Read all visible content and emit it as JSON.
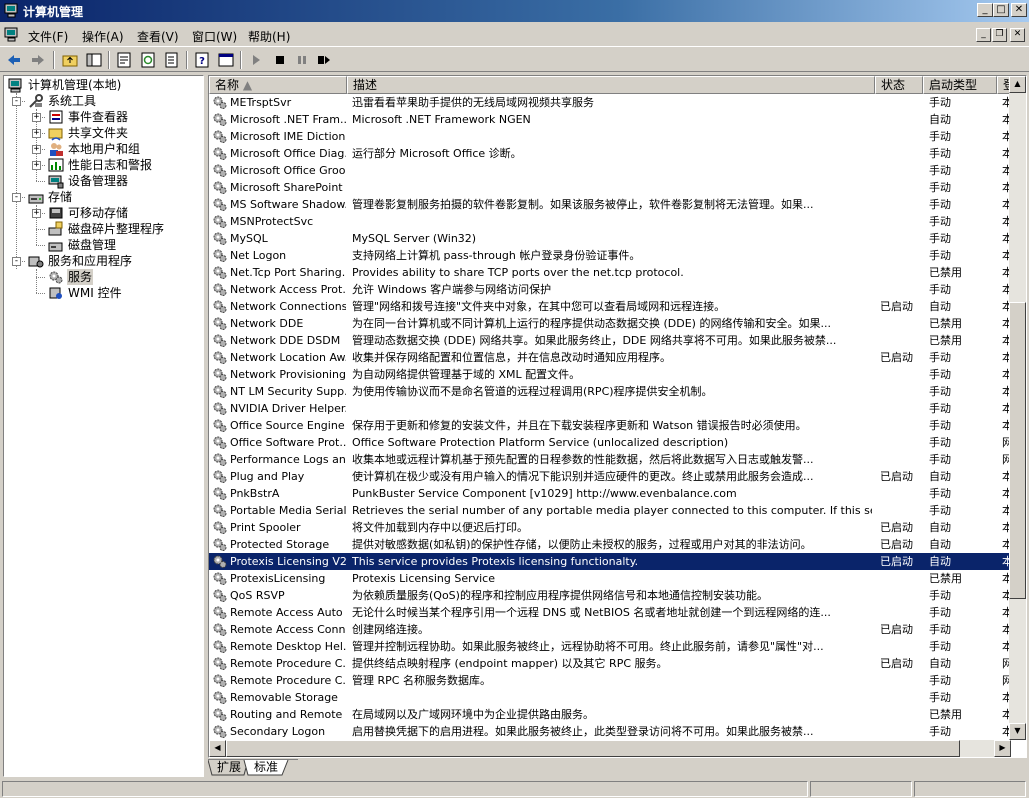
{
  "window": {
    "title": "计算机管理"
  },
  "menu": [
    "文件(F)",
    "操作(A)",
    "查看(V)",
    "窗口(W)",
    "帮助(H)"
  ],
  "toolbar": {
    "icons": [
      "back-icon",
      "forward-icon",
      "up-folder-icon",
      "show-hide-tree-icon",
      "properties-icon",
      "refresh-icon",
      "export-list-icon",
      "help-icon",
      "console-view-icon",
      "start-service-icon",
      "stop-service-icon",
      "pause-service-icon",
      "restart-service-icon"
    ]
  },
  "tree": {
    "root": "计算机管理(本地)",
    "system_tools": "系统工具",
    "event_viewer": "事件查看器",
    "shared_folders": "共享文件夹",
    "local_users": "本地用户和组",
    "perf_logs": "性能日志和警报",
    "device_manager": "设备管理器",
    "storage": "存储",
    "removable_storage": "可移动存储",
    "defrag": "磁盘碎片整理程序",
    "disk_mgmt": "磁盘管理",
    "services_apps": "服务和应用程序",
    "services": "服务",
    "wmi": "WMI 控件"
  },
  "list": {
    "columns": [
      "名称",
      "描述",
      "状态",
      "启动类型",
      "登"
    ],
    "rows": [
      {
        "name": "METrsptSvr",
        "desc": "迅雷看看苹果助手提供的无线局域网视频共享服务",
        "status": "",
        "startup": "手动",
        "logon": "本"
      },
      {
        "name": "Microsoft .NET Fram...",
        "desc": "Microsoft .NET Framework NGEN",
        "status": "",
        "startup": "自动",
        "logon": "本"
      },
      {
        "name": "Microsoft IME Diction...",
        "desc": "",
        "status": "",
        "startup": "手动",
        "logon": "本"
      },
      {
        "name": "Microsoft Office Diag...",
        "desc": "运行部分 Microsoft Office 诊断。",
        "status": "",
        "startup": "手动",
        "logon": "本"
      },
      {
        "name": "Microsoft Office Groo...",
        "desc": "",
        "status": "",
        "startup": "手动",
        "logon": "本"
      },
      {
        "name": "Microsoft SharePoint ...",
        "desc": "",
        "status": "",
        "startup": "手动",
        "logon": "本"
      },
      {
        "name": "MS Software Shadow...",
        "desc": "管理卷影复制服务拍摄的软件卷影复制。如果该服务被停止，软件卷影复制将无法管理。如果...",
        "status": "",
        "startup": "手动",
        "logon": "本"
      },
      {
        "name": "MSNProtectSvc",
        "desc": "",
        "status": "",
        "startup": "手动",
        "logon": "本"
      },
      {
        "name": "MySQL",
        "desc": "MySQL Server (Win32)",
        "status": "",
        "startup": "手动",
        "logon": "本"
      },
      {
        "name": "Net Logon",
        "desc": "支持网络上计算机 pass-through 帐户登录身份验证事件。",
        "status": "",
        "startup": "手动",
        "logon": "本"
      },
      {
        "name": "Net.Tcp Port Sharing...",
        "desc": "Provides ability to share TCP ports over the net.tcp protocol.",
        "status": "",
        "startup": "已禁用",
        "logon": "本"
      },
      {
        "name": "Network Access Prot...",
        "desc": "允许 Windows 客户端参与网络访问保护",
        "status": "",
        "startup": "手动",
        "logon": "本"
      },
      {
        "name": "Network Connections",
        "desc": "管理\"网络和拨号连接\"文件夹中对象，在其中您可以查看局域网和远程连接。",
        "status": "已启动",
        "startup": "自动",
        "logon": "本"
      },
      {
        "name": "Network DDE",
        "desc": "为在同一台计算机或不同计算机上运行的程序提供动态数据交换 (DDE) 的网络传输和安全。如果...",
        "status": "",
        "startup": "已禁用",
        "logon": "本"
      },
      {
        "name": "Network DDE DSDM",
        "desc": "管理动态数据交换 (DDE) 网络共享。如果此服务终止，DDE 网络共享将不可用。如果此服务被禁...",
        "status": "",
        "startup": "已禁用",
        "logon": "本"
      },
      {
        "name": "Network Location Aw...",
        "desc": "收集并保存网络配置和位置信息，并在信息改动时通知应用程序。",
        "status": "已启动",
        "startup": "手动",
        "logon": "本"
      },
      {
        "name": "Network Provisioning...",
        "desc": "为自动网络提供管理基于域的 XML 配置文件。",
        "status": "",
        "startup": "手动",
        "logon": "本"
      },
      {
        "name": "NT LM Security Supp...",
        "desc": "为使用传输协议而不是命名管道的远程过程调用(RPC)程序提供安全机制。",
        "status": "",
        "startup": "手动",
        "logon": "本"
      },
      {
        "name": "NVIDIA Driver Helper...",
        "desc": "",
        "status": "",
        "startup": "手动",
        "logon": "本"
      },
      {
        "name": "Office  Source Engine",
        "desc": "保存用于更新和修复的安装文件，并且在下载安装程序更新和 Watson 错误报告时必须使用。",
        "status": "",
        "startup": "手动",
        "logon": "本"
      },
      {
        "name": "Office Software Prot...",
        "desc": "Office Software Protection Platform Service (unlocalized description)",
        "status": "",
        "startup": "手动",
        "logon": "网"
      },
      {
        "name": "Performance Logs an...",
        "desc": "收集本地或远程计算机基于预先配置的日程参数的性能数据，然后将此数据写入日志或触发警...",
        "status": "",
        "startup": "手动",
        "logon": "网"
      },
      {
        "name": "Plug and Play",
        "desc": "使计算机在极少或没有用户输入的情况下能识别并适应硬件的更改。终止或禁用此服务会造成...",
        "status": "已启动",
        "startup": "自动",
        "logon": "本"
      },
      {
        "name": "PnkBstrA",
        "desc": "PunkBuster Service Component [v1029] http://www.evenbalance.com",
        "status": "",
        "startup": "手动",
        "logon": "本"
      },
      {
        "name": "Portable Media Serial...",
        "desc": "Retrieves the serial number of any portable media player connected to this computer. If this service is st...",
        "status": "",
        "startup": "手动",
        "logon": "本"
      },
      {
        "name": "Print Spooler",
        "desc": "将文件加载到内存中以便迟后打印。",
        "status": "已启动",
        "startup": "自动",
        "logon": "本"
      },
      {
        "name": "Protected Storage",
        "desc": "提供对敏感数据(如私钥)的保护性存储，以便防止未授权的服务，过程或用户对其的非法访问。",
        "status": "已启动",
        "startup": "自动",
        "logon": "本"
      },
      {
        "name": "Protexis Licensing V2",
        "desc": "This service provides Protexis licensing functionalty.",
        "status": "已启动",
        "startup": "自动",
        "logon": "本"
      },
      {
        "name": "ProtexisLicensing",
        "desc": "Protexis Licensing Service",
        "status": "",
        "startup": "已禁用",
        "logon": "本"
      },
      {
        "name": "QoS RSVP",
        "desc": "为依赖质量服务(QoS)的程序和控制应用程序提供网络信号和本地通信控制安装功能。",
        "status": "",
        "startup": "手动",
        "logon": "本"
      },
      {
        "name": "Remote Access Auto ...",
        "desc": "无论什么时候当某个程序引用一个远程 DNS 或 NetBIOS 名或者地址就创建一个到远程网络的连...",
        "status": "",
        "startup": "手动",
        "logon": "本"
      },
      {
        "name": "Remote Access Conn...",
        "desc": "创建网络连接。",
        "status": "已启动",
        "startup": "手动",
        "logon": "本"
      },
      {
        "name": "Remote Desktop Hel...",
        "desc": "管理并控制远程协助。如果此服务被终止，远程协助将不可用。终止此服务前，请参见\"属性\"对...",
        "status": "",
        "startup": "手动",
        "logon": "本"
      },
      {
        "name": "Remote Procedure C...",
        "desc": "提供终结点映射程序 (endpoint mapper) 以及其它 RPC 服务。",
        "status": "已启动",
        "startup": "自动",
        "logon": "网"
      },
      {
        "name": "Remote Procedure C...",
        "desc": "管理 RPC 名称服务数据库。",
        "status": "",
        "startup": "手动",
        "logon": "网"
      },
      {
        "name": "Removable Storage",
        "desc": "",
        "status": "",
        "startup": "手动",
        "logon": "本"
      },
      {
        "name": "Routing and Remote ...",
        "desc": "在局域网以及广域网环境中为企业提供路由服务。",
        "status": "",
        "startup": "已禁用",
        "logon": "本"
      },
      {
        "name": "Secondary Logon",
        "desc": "启用替换凭据下的启用进程。如果此服务被终止，此类型登录访问将不可用。如果此服务被禁...",
        "status": "",
        "startup": "手动",
        "logon": "本"
      }
    ],
    "selected_index": 27
  },
  "tabs": [
    "扩展",
    "标准"
  ],
  "active_tab": "标准",
  "colors": {
    "title_start": "#0a246a",
    "title_end": "#a6caf0",
    "selection": "#0a246a",
    "face": "#d4d0c8"
  }
}
